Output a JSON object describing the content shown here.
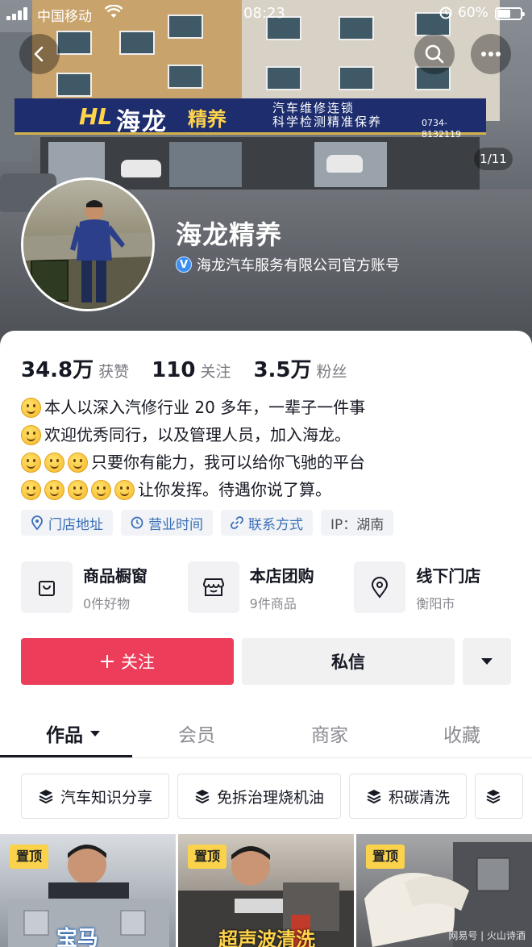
{
  "status_bar": {
    "carrier": "中国移动",
    "time": "08:23",
    "battery": "60%"
  },
  "header": {
    "image_counter": "1/11",
    "shop_sign": {
      "logo": "HL",
      "name": "海龙",
      "name2": "精养",
      "tagline_1": "汽车维修连锁",
      "tagline_2": "科学检测精准保养",
      "phone": "0734-8132119"
    }
  },
  "profile": {
    "name": "海龙精养",
    "verification": "海龙汽车服务有限公司官方账号"
  },
  "stats": [
    {
      "value": "34.8万",
      "label": "获赞"
    },
    {
      "value": "110",
      "label": "关注"
    },
    {
      "value": "3.5万",
      "label": "粉丝"
    }
  ],
  "bio": {
    "line1": "本人以深入汽修行业 20 多年，一辈子一件事",
    "line2": "欢迎优秀同行，以及管理人员，加入海龙。",
    "line3": "只要你有能力，我可以给你飞驰的平台",
    "line4": "让你发挥。待遇你说了算。"
  },
  "tags": [
    {
      "label": "门店地址",
      "icon": "location-pin-icon"
    },
    {
      "label": "营业时间",
      "icon": "clock-icon"
    },
    {
      "label": "联系方式",
      "icon": "link-icon"
    },
    {
      "label": "IP：湖南"
    }
  ],
  "shop_entries": [
    {
      "title": "商品橱窗",
      "subtitle": "0件好物",
      "icon": "shopping-bag-icon"
    },
    {
      "title": "本店团购",
      "subtitle": "9件商品",
      "icon": "storefront-icon"
    },
    {
      "title": "线下门店",
      "subtitle": "衡阳市",
      "icon": "location-pin-icon"
    }
  ],
  "actions": {
    "follow": "关注",
    "message": "私信"
  },
  "tabs": [
    "作品",
    "会员",
    "商家",
    "收藏"
  ],
  "chips": [
    "汽车知识分享",
    "免拆治理烧机油",
    "积碳清洗"
  ],
  "videos": [
    {
      "badge": "置顶",
      "caption": "宝马"
    },
    {
      "badge": "置顶",
      "caption": "超声波清洗"
    },
    {
      "badge": "置顶"
    }
  ],
  "watermark": "网易号 | 火山诗酒",
  "colors": {
    "follow_button": "#ec3d5a",
    "pin_badge": "#fbd24b",
    "tag_text": "#3a6fb8"
  }
}
